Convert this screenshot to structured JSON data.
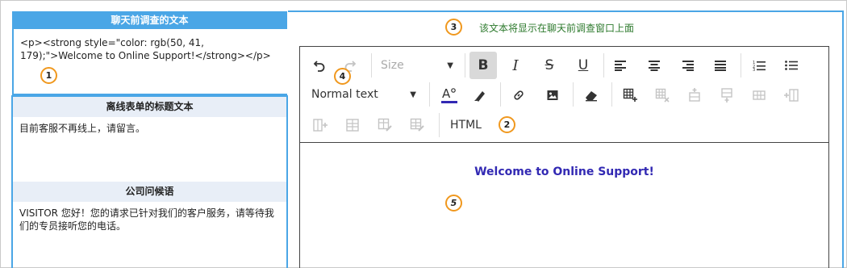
{
  "left": {
    "chat_prompt": {
      "title": "聊天前调查的文本",
      "content": "<p><strong style=\"color: rgb(50, 41, 179);\">Welcome to Online Support!</strong></p>"
    },
    "offline_form": {
      "title": "离线表单的标题文本",
      "content": "目前客服不再线上，请留言。"
    },
    "greeting": {
      "title": "公司问候语",
      "content": "VISITOR 您好！您的请求已针对我们的客户服务，请等待我们的专员接听您的电话。"
    }
  },
  "right": {
    "caption": "该文本将显示在聊天前调查窗口上面"
  },
  "editor": {
    "size_placeholder": "Size",
    "paragraph_format": "Normal text",
    "html_label": "HTML",
    "content_text": "Welcome to Online Support!",
    "content_color": "#3229b3"
  },
  "badges": [
    "1",
    "2",
    "3",
    "4",
    "5"
  ],
  "colors": {
    "accent_blue": "#4aa6e6",
    "callout_orange": "#f0981e",
    "caption_green": "#2d7a2d"
  }
}
